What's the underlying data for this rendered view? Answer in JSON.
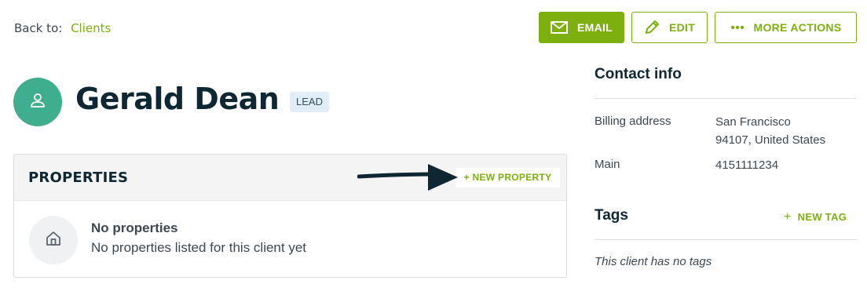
{
  "breadcrumb": {
    "prefix": "Back to:",
    "link": "Clients"
  },
  "actions": {
    "email": "EMAIL",
    "edit": "EDIT",
    "more": "MORE ACTIONS"
  },
  "client": {
    "name": "Gerald Dean",
    "status": "LEAD"
  },
  "properties": {
    "title": "PROPERTIES",
    "new_label": "+ NEW PROPERTY",
    "empty_title": "No properties",
    "empty_message": "No properties listed for this client yet"
  },
  "contact": {
    "title": "Contact info",
    "billing_label": "Billing address",
    "billing_line1": "San Francisco",
    "billing_line2": "94107, United States",
    "main_label": "Main",
    "main_value": "4151111234"
  },
  "tags": {
    "title": "Tags",
    "new_label": "NEW TAG",
    "empty": "This client has no tags"
  },
  "colors": {
    "accent": "#7db00e",
    "avatar": "#3fae8f",
    "heading": "#0f2733",
    "badge_bg": "#e2eef7"
  },
  "icons": [
    "envelope-icon",
    "pencil-icon",
    "ellipsis-icon",
    "person-icon",
    "house-icon",
    "plus-icon",
    "arrow-icon"
  ]
}
